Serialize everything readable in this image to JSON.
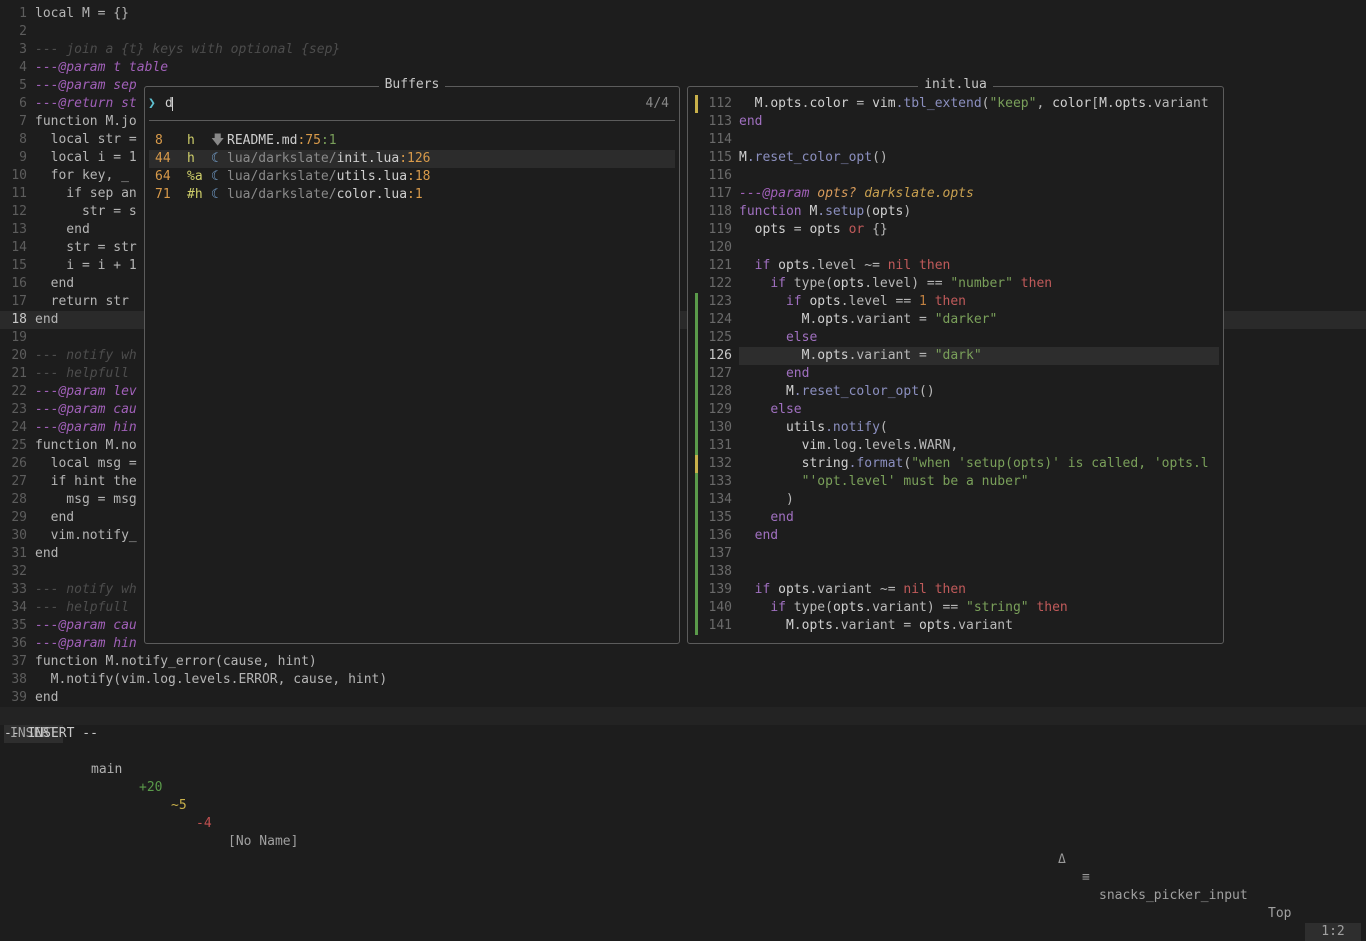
{
  "background_lines": [
    {
      "n": "1",
      "text": "local M = {}",
      "cls": "t-kw"
    },
    {
      "n": "2",
      "text": "",
      "cls": ""
    },
    {
      "n": "3",
      "text": "--- join a {t} keys with optional {sep}",
      "cls": "t-cm"
    },
    {
      "n": "4",
      "text": "---@param t table",
      "cls": "t-an"
    },
    {
      "n": "5",
      "text": "---@param sep",
      "cls": "t-an"
    },
    {
      "n": "6",
      "text": "---@return st",
      "cls": "t-an"
    },
    {
      "n": "7",
      "text": "function M.jo",
      "cls": "t-kw"
    },
    {
      "n": "8",
      "text": "  local str =",
      "cls": "t-kw"
    },
    {
      "n": "9",
      "text": "  local i = 1",
      "cls": "t-kw"
    },
    {
      "n": "10",
      "text": "  for key, _",
      "cls": "t-kw"
    },
    {
      "n": "11",
      "text": "    if sep an",
      "cls": "t-kw"
    },
    {
      "n": "12",
      "text": "      str = s",
      "cls": "t-kw"
    },
    {
      "n": "13",
      "text": "    end",
      "cls": "t-kw"
    },
    {
      "n": "14",
      "text": "    str = str",
      "cls": "t-kw"
    },
    {
      "n": "15",
      "text": "    i = i + 1",
      "cls": "t-kw"
    },
    {
      "n": "16",
      "text": "  end",
      "cls": "t-kw"
    },
    {
      "n": "17",
      "text": "  return str",
      "cls": "t-kw"
    },
    {
      "n": "18",
      "text": "end",
      "cls": "t-kw"
    },
    {
      "n": "19",
      "text": "",
      "cls": ""
    },
    {
      "n": "20",
      "text": "--- notify wh",
      "cls": "t-cm"
    },
    {
      "n": "21",
      "text": "--- helpfull",
      "cls": "t-cm"
    },
    {
      "n": "22",
      "text": "---@param lev",
      "cls": "t-an"
    },
    {
      "n": "23",
      "text": "---@param cau",
      "cls": "t-an"
    },
    {
      "n": "24",
      "text": "---@param hin",
      "cls": "t-an"
    },
    {
      "n": "25",
      "text": "function M.no",
      "cls": "t-kw"
    },
    {
      "n": "26",
      "text": "  local msg =",
      "cls": "t-kw"
    },
    {
      "n": "27",
      "text": "  if hint the",
      "cls": "t-kw"
    },
    {
      "n": "28",
      "text": "    msg = msg",
      "cls": "t-kw"
    },
    {
      "n": "29",
      "text": "  end",
      "cls": "t-kw"
    },
    {
      "n": "30",
      "text": "  vim.notify_",
      "cls": "t-kw"
    },
    {
      "n": "31",
      "text": "end",
      "cls": "t-kw"
    },
    {
      "n": "32",
      "text": "",
      "cls": ""
    },
    {
      "n": "33",
      "text": "--- notify wh",
      "cls": "t-cm"
    },
    {
      "n": "34",
      "text": "--- helpfull",
      "cls": "t-cm"
    },
    {
      "n": "35",
      "text": "---@param cau",
      "cls": "t-an"
    },
    {
      "n": "36",
      "text": "---@param hin",
      "cls": "t-an"
    },
    {
      "n": "37",
      "text": "function M.notify_error(cause, hint)",
      "cls": "t-kw"
    },
    {
      "n": "38",
      "text": "  M.notify(vim.log.levels.ERROR, cause, hint)",
      "cls": "t-kw"
    },
    {
      "n": "39",
      "text": "end",
      "cls": "t-kw"
    }
  ],
  "buffers_window": {
    "title": "Buffers",
    "prompt_icon": "❯",
    "query": "d",
    "count": "4/4",
    "items": [
      {
        "num": "8",
        "flags": "h",
        "icon": "markdown-icon",
        "glyph": "🡇",
        "path": "README.md",
        "line": ":75",
        "col": ":1",
        "selected": false
      },
      {
        "num": "44",
        "flags": "h",
        "icon": "lua-icon",
        "glyph": "☾",
        "path": "lua/darkslate/init.lua",
        "line": ":126",
        "col": "",
        "selected": true
      },
      {
        "num": "64",
        "flags": "%a",
        "icon": "lua-icon",
        "glyph": "☾",
        "path": "lua/darkslate/utils.lua",
        "line": ":18",
        "col": "",
        "selected": false
      },
      {
        "num": "71",
        "flags": "#h",
        "icon": "lua-icon",
        "glyph": "☾",
        "path": "lua/darkslate/color.lua",
        "line": ":1",
        "col": "",
        "selected": false
      }
    ]
  },
  "preview_window": {
    "title": "init.lua",
    "current_line": "126",
    "lines": [
      {
        "n": "112",
        "sign": "#c8b04a",
        "text": "  M.opts.color = vim.tbl_extend(\"keep\", color[M.opts.variant"
      },
      {
        "n": "113",
        "sign": "",
        "text": "end"
      },
      {
        "n": "114",
        "sign": "",
        "text": ""
      },
      {
        "n": "115",
        "sign": "",
        "text": "M.reset_color_opt()"
      },
      {
        "n": "116",
        "sign": "",
        "text": ""
      },
      {
        "n": "117",
        "sign": "",
        "text": "---@param opts? darkslate.opts"
      },
      {
        "n": "118",
        "sign": "",
        "text": "function M.setup(opts)"
      },
      {
        "n": "119",
        "sign": "",
        "text": "  opts = opts or {}"
      },
      {
        "n": "120",
        "sign": "",
        "text": ""
      },
      {
        "n": "121",
        "sign": "",
        "text": "  if opts.level ~= nil then"
      },
      {
        "n": "122",
        "sign": "",
        "text": "    if type(opts.level) == \"number\" then"
      },
      {
        "n": "123",
        "sign": "#5a9a4a",
        "text": "      if opts.level == 1 then"
      },
      {
        "n": "124",
        "sign": "#5a9a4a",
        "text": "        M.opts.variant = \"darker\""
      },
      {
        "n": "125",
        "sign": "#5a9a4a",
        "text": "      else"
      },
      {
        "n": "126",
        "sign": "#5a9a4a",
        "text": "        M.opts.variant = \"dark\""
      },
      {
        "n": "127",
        "sign": "#5a9a4a",
        "text": "      end"
      },
      {
        "n": "128",
        "sign": "#5a9a4a",
        "text": "      M.reset_color_opt()"
      },
      {
        "n": "129",
        "sign": "#5a9a4a",
        "text": "    else"
      },
      {
        "n": "130",
        "sign": "#5a9a4a",
        "text": "      utils.notify("
      },
      {
        "n": "131",
        "sign": "#5a9a4a",
        "text": "        vim.log.levels.WARN,"
      },
      {
        "n": "132",
        "sign": "#c8b04a",
        "text": "        string.format(\"when 'setup(opts)' is called, 'opts.l"
      },
      {
        "n": "133",
        "sign": "#5a9a4a",
        "text": "        \"'opt.level' must be a nuber\""
      },
      {
        "n": "134",
        "sign": "#5a9a4a",
        "text": "      )"
      },
      {
        "n": "135",
        "sign": "#5a9a4a",
        "text": "    end"
      },
      {
        "n": "136",
        "sign": "#5a9a4a",
        "text": "  end"
      },
      {
        "n": "137",
        "sign": "#5a9a4a",
        "text": ""
      },
      {
        "n": "138",
        "sign": "#5a9a4a",
        "text": ""
      },
      {
        "n": "139",
        "sign": "#5a9a4a",
        "text": "  if opts.variant ~= nil then"
      },
      {
        "n": "140",
        "sign": "#5a9a4a",
        "text": "    if type(opts.variant) == \"string\" then"
      },
      {
        "n": "141",
        "sign": "#5a9a4a",
        "text": "      M.opts.variant = opts.variant"
      }
    ]
  },
  "statusline": {
    "mode": "INSERT",
    "branch_icon": "",
    "branch": "main",
    "added": "+20",
    "changed": "~5",
    "removed": "-4",
    "filename": "[No Name]",
    "diag_icon": "Δ",
    "filetype_icon": "≡",
    "filetype": "snacks_picker_input",
    "position": "Top",
    "cursor": "1:2"
  },
  "cmdline": "-- INSERT --",
  "colors": {
    "background": "#1d1d1d",
    "border": "#5c5c5c",
    "accent_orange": "#d89a4a",
    "git_added": "#5a9a4a",
    "git_changed": "#c8b04a",
    "string_green": "#7aa05a",
    "annotation_purple": "#a060b8"
  }
}
